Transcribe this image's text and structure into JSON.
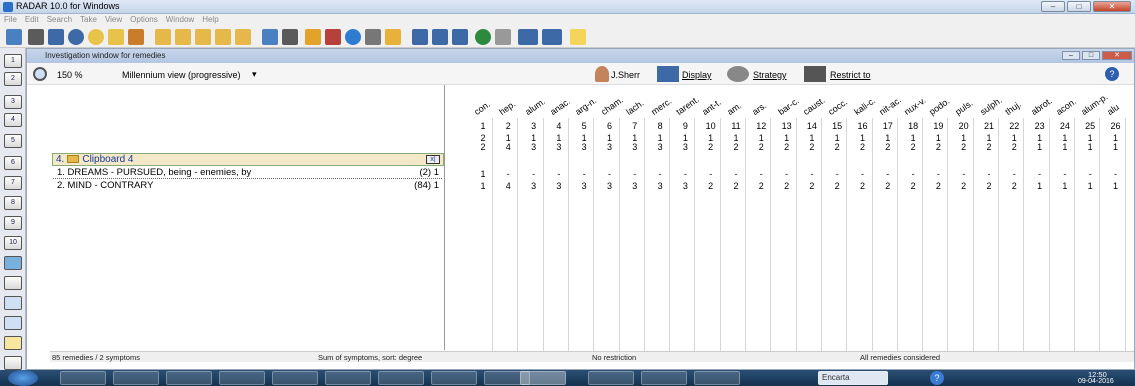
{
  "window": {
    "title": "RADAR 10.0 for Windows"
  },
  "menu": [
    "File",
    "Edit",
    "Search",
    "Take",
    "View",
    "Options",
    "Window",
    "Help"
  ],
  "inner": {
    "title": "Investigation window for remedies"
  },
  "toolrow": {
    "zoom": "150 %",
    "view": "Millennium view (progressive)",
    "user": "J.Sherr",
    "display": "Display",
    "strategy": "Strategy",
    "restrict": "Restrict to"
  },
  "leftbar": [
    "1",
    "2",
    "3",
    "4",
    "5",
    "6",
    "7",
    "8",
    "9",
    "10"
  ],
  "clipboard": {
    "title": "4.",
    "name": "Clipboard 4",
    "close": "x|"
  },
  "symptoms": [
    {
      "label": "1. DREAMS - PURSUED, being - enemies, by",
      "count": "(2) 1"
    },
    {
      "label": "2. MIND - CONTRARY",
      "count": "(84) 1"
    }
  ],
  "remedies": [
    "con.",
    "hep.",
    "alum.",
    "anac.",
    "arg-n.",
    "cham.",
    "lach.",
    "merc.",
    "tarent.",
    "ant-t.",
    "am.",
    "ars.",
    "bar-c.",
    "caust.",
    "cocc.",
    "kali-c.",
    "nit-ac.",
    "nux-v.",
    "podo.",
    "puls.",
    "sulph.",
    "thuj.",
    "abrot.",
    "acon.",
    "alum-p.",
    "alu"
  ],
  "cols": [
    "1",
    "2",
    "3",
    "4",
    "5",
    "6",
    "7",
    "8",
    "9",
    "10",
    "11",
    "12",
    "13",
    "14",
    "15",
    "16",
    "17",
    "18",
    "19",
    "20",
    "21",
    "22",
    "23",
    "24",
    "25",
    "26"
  ],
  "scores": [
    "2",
    "1",
    "1",
    "1",
    "1",
    "1",
    "1",
    "1",
    "1",
    "1",
    "1",
    "1",
    "1",
    "1",
    "1",
    "1",
    "1",
    "1",
    "1",
    "1",
    "1",
    "1",
    "1",
    "1",
    "1",
    "1"
  ],
  "degrees": [
    "2",
    "4",
    "3",
    "3",
    "3",
    "3",
    "3",
    "3",
    "3",
    "2",
    "2",
    "2",
    "2",
    "2",
    "2",
    "2",
    "2",
    "2",
    "2",
    "2",
    "2",
    "2",
    "1",
    "1",
    "1",
    "1"
  ],
  "row1": [
    "1",
    "-",
    "-",
    "-",
    "-",
    "-",
    "-",
    "-",
    "-",
    "-",
    "-",
    "-",
    "-",
    "-",
    "-",
    "-",
    "-",
    "-",
    "-",
    "-",
    "-",
    "-",
    "-",
    "-",
    "-",
    "-"
  ],
  "row2": [
    "1",
    "4",
    "3",
    "3",
    "3",
    "3",
    "3",
    "3",
    "3",
    "2",
    "2",
    "2",
    "2",
    "2",
    "2",
    "2",
    "2",
    "2",
    "2",
    "2",
    "2",
    "2",
    "1",
    "1",
    "1",
    "1"
  ],
  "status": {
    "left": "85 remedies / 2 symptoms",
    "sort": "Sum of symptoms, sort: degree",
    "restriction": "No restriction",
    "remedies": "All remedies considered"
  },
  "taskbar": {
    "search": "Encarta",
    "time": "12:50",
    "date": "09-04-2016"
  }
}
